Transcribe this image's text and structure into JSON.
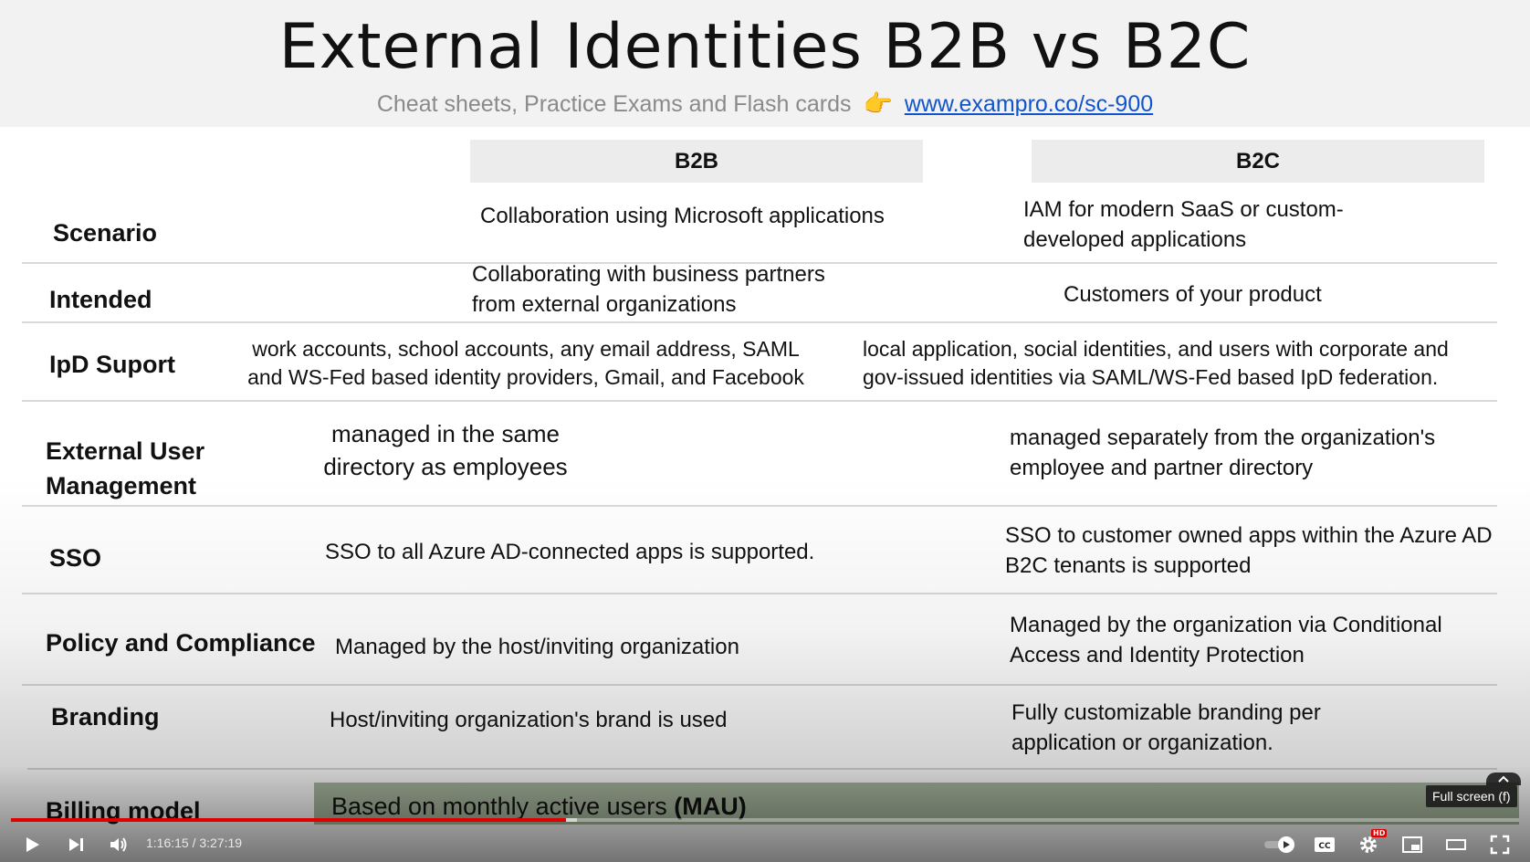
{
  "slide": {
    "title": "External Identities B2B vs B2C",
    "subtitle_text": "Cheat sheets, Practice Exams and Flash cards",
    "subtitle_link": "www.exampro.co/sc-900",
    "columns": {
      "b2b": "B2B",
      "b2c": "B2C"
    },
    "rows": [
      {
        "label": "Scenario",
        "b2b": "Collaboration using Microsoft applications",
        "b2c": "IAM for modern SaaS or custom-developed applications"
      },
      {
        "label": "Intended",
        "b2b": "Collaborating with business partners from external organizations",
        "b2c": "Customers of your product"
      },
      {
        "label": "IpD Suport",
        "b2b": "work accounts, school accounts, any email address, SAML and WS-Fed based identity providers, Gmail, and Facebook",
        "b2c": "local application, social identities, and users with corporate and gov-issued identities via SAML/WS-Fed based IpD federation."
      },
      {
        "label": "External User Management",
        "b2b": "managed in the same directory as employees",
        "b2c": "managed separately from the organization's employee and partner directory"
      },
      {
        "label": "SSO",
        "b2b": "SSO to all Azure AD-connected apps is supported.",
        "b2c": "SSO to customer owned apps within the Azure AD B2C tenants is supported"
      },
      {
        "label": "Policy and Compliance",
        "b2b": "Managed by the host/inviting organization",
        "b2c": "Managed by the organization via Conditional Access and Identity Protection"
      },
      {
        "label": "Branding",
        "b2b": "Host/inviting organization's brand is used",
        "b2c": "Fully customizable branding per application or organization."
      },
      {
        "label": "Billing model",
        "value": "Based on monthly active users",
        "value_bold": "(MAU)"
      }
    ]
  },
  "player": {
    "time_display": "1:16:15 / 3:27:19",
    "progress_fraction": 0.368,
    "buffer_fraction": 0.375,
    "tooltip": "Full screen (f)",
    "hd_badge": "HD",
    "icons": [
      "play-icon",
      "next-icon",
      "volume-icon",
      "autoplay-toggle-icon",
      "captions-icon",
      "settings-icon",
      "miniplayer-icon",
      "theater-icon",
      "fullscreen-icon"
    ]
  }
}
